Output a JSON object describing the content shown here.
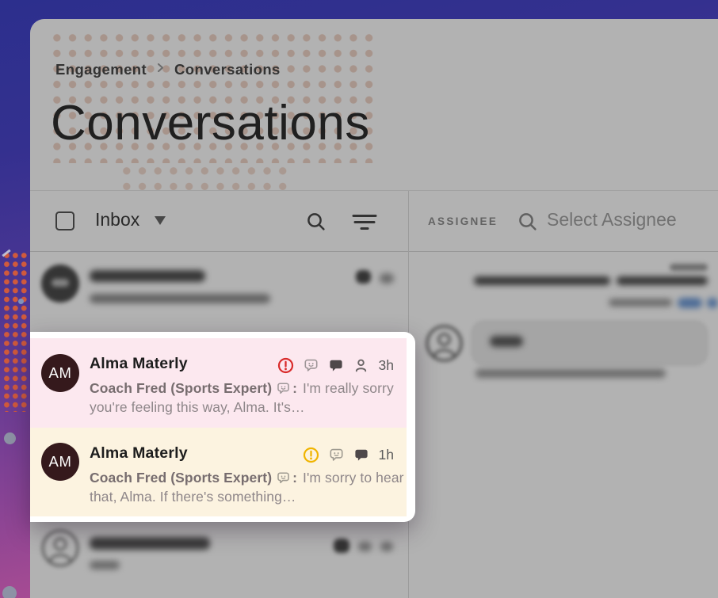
{
  "breadcrumb": {
    "section": "Engagement",
    "current": "Conversations"
  },
  "page": {
    "title": "Conversations"
  },
  "toolbar": {
    "inbox_label": "Inbox"
  },
  "assignee": {
    "label": "ASSIGNEE",
    "placeholder": "Select Assignee"
  },
  "conversations": [
    {
      "initials": "AM",
      "name": "Alma Materly",
      "author": "Coach Fred (Sports Expert)",
      "separator": ":",
      "snippet": "I'm really sorry you're feeling this way, Alma. It's…",
      "time": "3h",
      "alert_level": "red"
    },
    {
      "initials": "AM",
      "name": "Alma Materly",
      "author": "Coach Fred (Sports Expert)",
      "separator": ":",
      "snippet": "I'm sorry to hear that, Alma. If there's something…",
      "time": "1h",
      "alert_level": "yellow"
    }
  ],
  "icons": {
    "alert": "alert-circle-icon",
    "bot": "bot-message-icon",
    "chat": "chat-bubble-icon",
    "person": "assignee-person-icon",
    "search": "search-icon",
    "filter": "filter-icon",
    "caret": "caret-down-icon",
    "checkbox": "select-all-checkbox"
  },
  "colors": {
    "alert_red": "#d92b2b",
    "alert_yellow": "#f0b400",
    "row_pink": "#fce8ef",
    "row_cream": "#fcf3e0",
    "avatar_bg": "#35191c",
    "gradient_top": "#2c2f8d",
    "gradient_bottom": "#c95e95"
  }
}
